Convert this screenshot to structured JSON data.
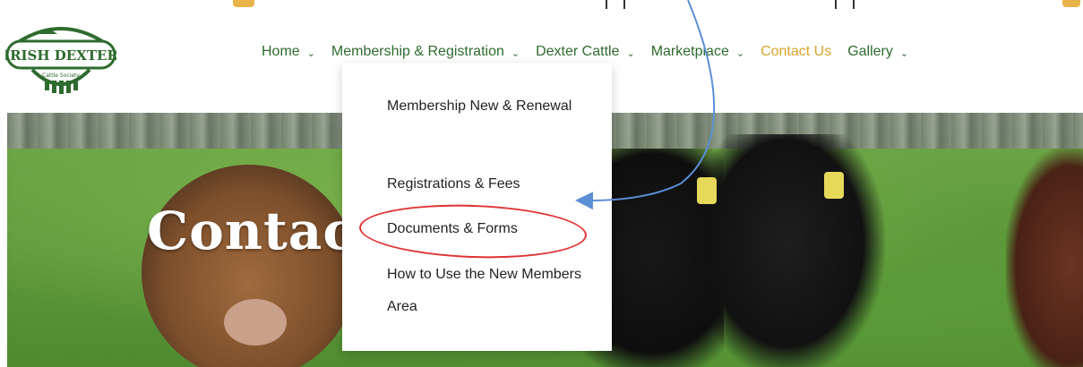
{
  "brand": {
    "logo_text": "IRISH DEXTER",
    "logo_subtext": "Cattle Society"
  },
  "nav": {
    "items": [
      {
        "label": "Home",
        "has_dropdown": true
      },
      {
        "label": "Membership & Registration",
        "has_dropdown": true
      },
      {
        "label": "Dexter Cattle",
        "has_dropdown": true
      },
      {
        "label": "Marketplace",
        "has_dropdown": true
      },
      {
        "label": "Contact Us",
        "has_dropdown": false
      },
      {
        "label": "Gallery",
        "has_dropdown": true
      }
    ],
    "chevron_glyph": "⌄"
  },
  "dropdown": {
    "items": [
      "Membership New & Renewal",
      "Registrations & Fees",
      "Documents & Forms",
      "How to Use the New Members Area"
    ]
  },
  "hero": {
    "title": "Contac"
  },
  "colors": {
    "nav_green": "#2e6b2e",
    "accent_gold": "#d6a52a",
    "annotation_red": "#e03232",
    "annotation_blue": "#5b8fd6"
  }
}
